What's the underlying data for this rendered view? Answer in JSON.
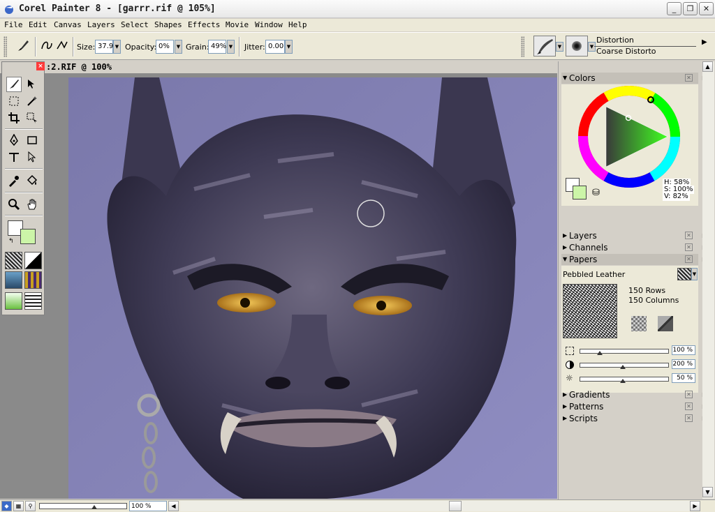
{
  "window": {
    "title": "Corel Painter 8 - [garrr.rif @ 105%]"
  },
  "menu": [
    "File",
    "Edit",
    "Canvas",
    "Layers",
    "Select",
    "Shapes",
    "Effects",
    "Movie",
    "Window",
    "Help"
  ],
  "property_bar": {
    "size_label": "Size:",
    "size_value": "37.9",
    "opacity_label": "Opacity:",
    "opacity_value": "0%",
    "grain_label": "Grain:",
    "grain_value": "49%",
    "jitter_label": "Jitter:",
    "jitter_value": "0.00",
    "brush_category": "Distortion",
    "brush_variant": "Coarse Distorto"
  },
  "document": {
    "tab_title": ":2.RIF @ 100%"
  },
  "colors_panel": {
    "title": "Colors",
    "h": "H: 58%",
    "s": "S: 100%",
    "v": "V: 82%",
    "primary_color": "#ffffff",
    "secondary_color": "#ccf5a8"
  },
  "panels": {
    "layers": "Layers",
    "channels": "Channels",
    "papers": "Papers",
    "paper_name": "Pebbled Leather",
    "rows": "150 Rows",
    "columns": "150 Columns",
    "scale": "100 %",
    "contrast": "200 %",
    "brightness": "50 %",
    "gradients": "Gradients",
    "patterns": "Patterns",
    "scripts": "Scripts"
  },
  "status": {
    "zoom": "100 %"
  },
  "close_glyph": "×"
}
